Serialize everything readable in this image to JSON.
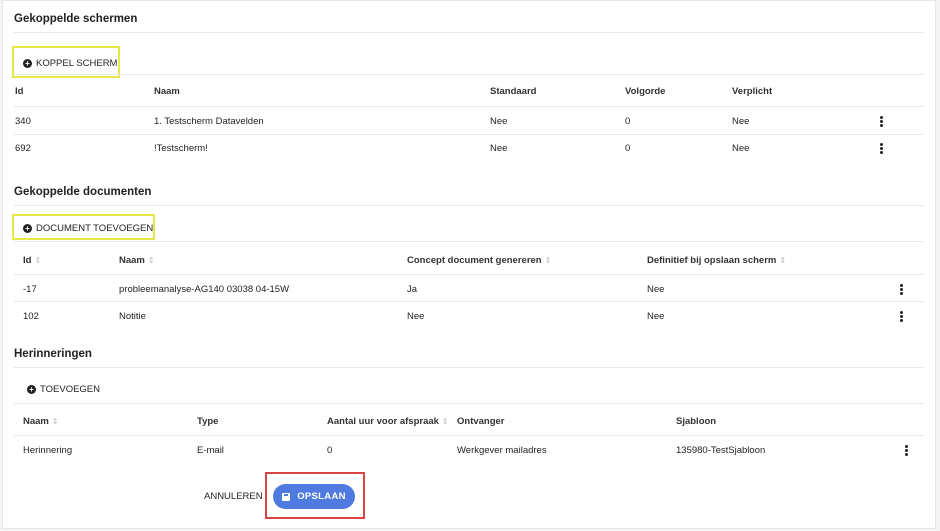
{
  "screens": {
    "title": "Gekoppelde schermen",
    "add_button": "KOPPEL SCHERM",
    "columns": [
      "Id",
      "Naam",
      "Standaard",
      "Volgorde",
      "Verplicht"
    ],
    "rows": [
      {
        "id": "340",
        "naam": "1. Testscherm Datavelden",
        "standaard": "Nee",
        "volgorde": "0",
        "verplicht": "Nee"
      },
      {
        "id": "692",
        "naam": "!Testscherm!",
        "standaard": "Nee",
        "volgorde": "0",
        "verplicht": "Nee"
      }
    ]
  },
  "documents": {
    "title": "Gekoppelde documenten",
    "add_button": "DOCUMENT TOEVOEGEN",
    "columns": [
      "Id",
      "Naam",
      "Concept document genereren",
      "Definitief bij opslaan scherm"
    ],
    "rows": [
      {
        "id": "-17",
        "naam": "probleemanalyse-AG140 03038 04-15W",
        "concept": "Ja",
        "definitief": "Nee"
      },
      {
        "id": "102",
        "naam": "Notitie",
        "concept": "Nee",
        "definitief": "Nee"
      }
    ]
  },
  "reminders": {
    "title": "Herinneringen",
    "add_button": "TOEVOEGEN",
    "columns": [
      "Naam",
      "Type",
      "Aantal uur voor afspraak",
      "Ontvanger",
      "Sjabloon"
    ],
    "rows": [
      {
        "naam": "Herinnering",
        "type": "E-mail",
        "uren": "0",
        "ontvanger": "Werkgever mailadres",
        "sjabloon": "135980-TestSjabloon"
      }
    ]
  },
  "footer": {
    "cancel_label": "ANNULEREN",
    "save_label": "OPSLAAN"
  },
  "icons": {
    "add": "plus-circle-icon",
    "row_menu": "more-vert-icon",
    "sort": "sort-icon",
    "save": "save-icon"
  },
  "colors": {
    "primary": "#4f7be0",
    "highlight_yellow": "#e5e84a",
    "highlight_red": "#d94545"
  }
}
